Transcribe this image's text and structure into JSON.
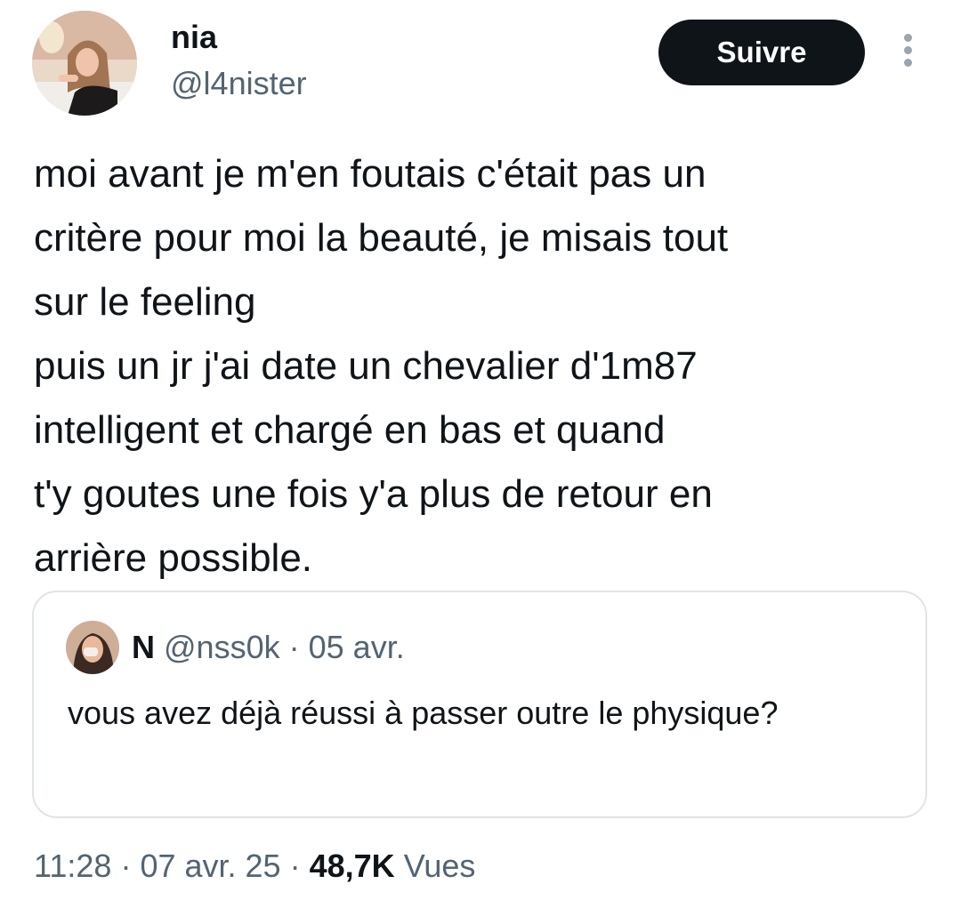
{
  "author": {
    "display_name": "nia",
    "handle": "@l4nister",
    "avatar_icon": "profile-photo"
  },
  "actions": {
    "follow_label": "Suivre",
    "more_icon": "vertical-ellipsis-icon"
  },
  "tweet": {
    "text": "moi avant je m'en foutais c'était pas un\ncritère pour moi la beauté, je misais tout\nsur le feeling\npuis un jr j'ai date un chevalier d'1m87\nintelligent et chargé en bas et quand\nt'y goutes une fois y'a plus de retour en\narrière possible."
  },
  "quoted_tweet": {
    "display_name": "N",
    "handle": "@nss0k",
    "separator": "·",
    "date": "05 avr.",
    "text": "vous avez déjà réussi à passer outre le physique?",
    "avatar_icon": "profile-photo"
  },
  "meta": {
    "time": "11:28",
    "separator1": "·",
    "date": "07 avr. 25",
    "separator2": "·",
    "views_count": "48,7K",
    "views_label": "Vues"
  },
  "colors": {
    "text_primary": "#0f1419",
    "text_secondary": "#536471",
    "button_bg": "#0f1419",
    "border": "#dfe4e8"
  }
}
